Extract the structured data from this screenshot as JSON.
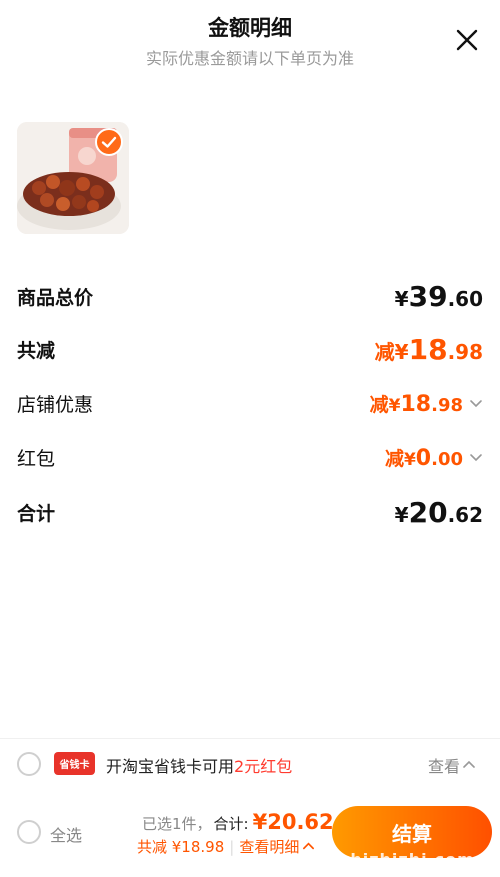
{
  "header": {
    "title": "金额明细",
    "subtitle": "实际优惠金额请以下单页为准"
  },
  "rows": {
    "goods_total": {
      "label": "商品总价",
      "currency": "¥",
      "int": "39",
      "dec": ".60"
    },
    "total_discount": {
      "label": "共减",
      "prefix": "减",
      "currency": "¥",
      "int": "18",
      "dec": ".98"
    },
    "store_discount": {
      "label": "店铺优惠",
      "prefix": "减",
      "currency": "¥",
      "int": "18",
      "dec": ".98"
    },
    "red_packet": {
      "label": "红包",
      "prefix": "减",
      "currency": "¥",
      "int": "0",
      "dec": ".00"
    },
    "sum": {
      "label": "合计",
      "currency": "¥",
      "int": "20",
      "dec": ".62"
    }
  },
  "promo": {
    "badge": "省钱卡",
    "text_before": "开淘宝省钱卡可用",
    "text_highlight": "2元红包",
    "view_label": "查看"
  },
  "footer": {
    "select_all": "全选",
    "selected_count": "已选1件，",
    "total_label": "合计:",
    "total_value": "¥20.62",
    "discount_text": "共减 ¥18.98",
    "details_label": "查看明细",
    "checkout_label": "结算",
    "watermark": "zhizhizhi.com"
  },
  "colors": {
    "accent_orange": "#ff5500",
    "checkout_gradient_start": "#ff9a00",
    "checkout_gradient_end": "#ff5000",
    "promo_highlight": "#ff3b2f",
    "badge_red": "#e8332a"
  }
}
